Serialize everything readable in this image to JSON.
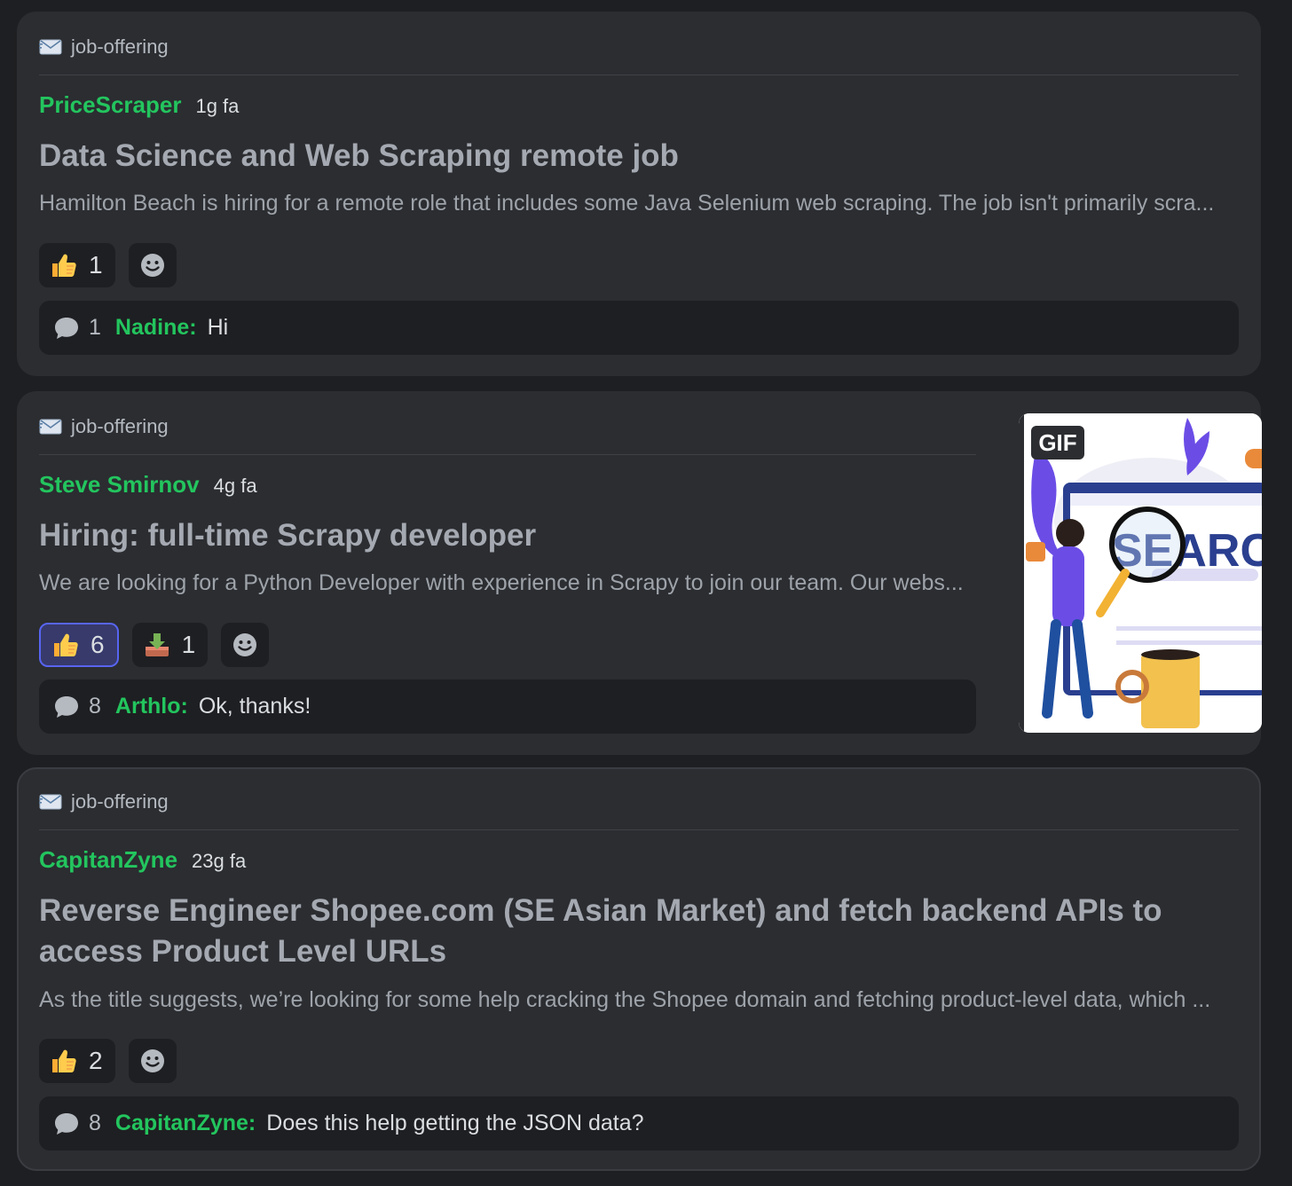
{
  "posts": [
    {
      "tag": "job-offering",
      "author": "PriceScraper",
      "time": "1g fa",
      "title": "Data Science and Web Scraping remote job",
      "snippet": "Hamilton Beach is hiring for a remote role that includes some Java Selenium web scraping. The job isn't primarily scra...",
      "reactions": [
        {
          "emoji": "thumbs-up-icon",
          "count": "1"
        }
      ],
      "reply": {
        "count": "1",
        "author": "Nadine:",
        "text": "Hi"
      }
    },
    {
      "tag": "job-offering",
      "author": "Steve Smirnov",
      "time": "4g fa",
      "title": "Hiring: full-time Scrapy developer",
      "snippet": "We are looking for a Python Developer with experience in Scrapy to join our team. Our webs...",
      "reactions": [
        {
          "emoji": "thumbs-up-icon",
          "count": "6",
          "active": true
        },
        {
          "emoji": "inbox-download-icon",
          "count": "1"
        }
      ],
      "reply": {
        "count": "8",
        "author": "Arthlo:",
        "text": "Ok, thanks!"
      },
      "thumbnail": {
        "badge": "GIF",
        "word": "SEARC"
      }
    },
    {
      "tag": "job-offering",
      "author": "CapitanZyne",
      "time": "23g fa",
      "title_line1": "Reverse Engineer Shopee.com (SE Asian Market) and fetch backend APIs to",
      "title_line2": "access Product Level URLs",
      "snippet": "As the title suggests, we’re looking for some help cracking the Shopee domain and fetching product-level data, which ...",
      "reactions": [
        {
          "emoji": "thumbs-up-icon",
          "count": "2"
        }
      ],
      "reply": {
        "count": "8",
        "author": "CapitanZyne:",
        "text": "Does this help getting the JSON data?"
      }
    }
  ],
  "colors": {
    "background": "#1e1f22",
    "card": "#2b2d31",
    "author": "#23c55e",
    "accent": "#5865f2"
  }
}
